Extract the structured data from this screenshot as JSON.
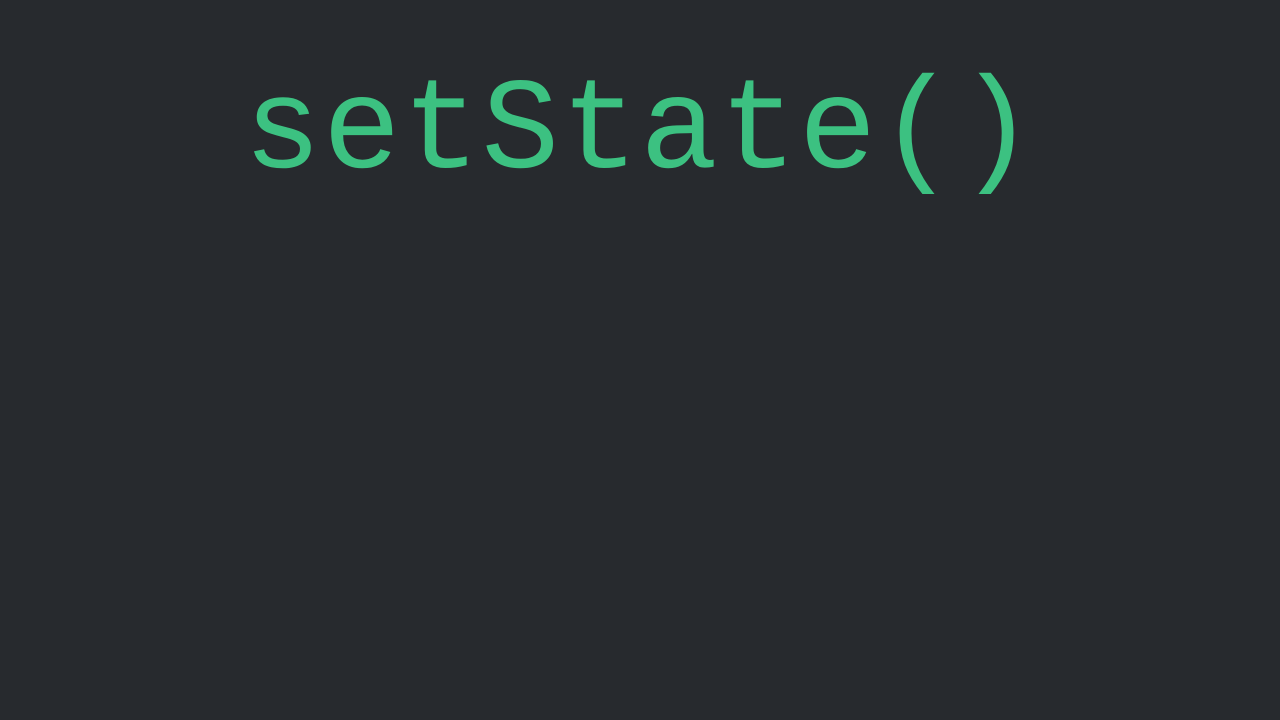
{
  "code": {
    "text": "setState()"
  },
  "colors": {
    "background": "#272a2e",
    "foreground": "#3cc181"
  }
}
